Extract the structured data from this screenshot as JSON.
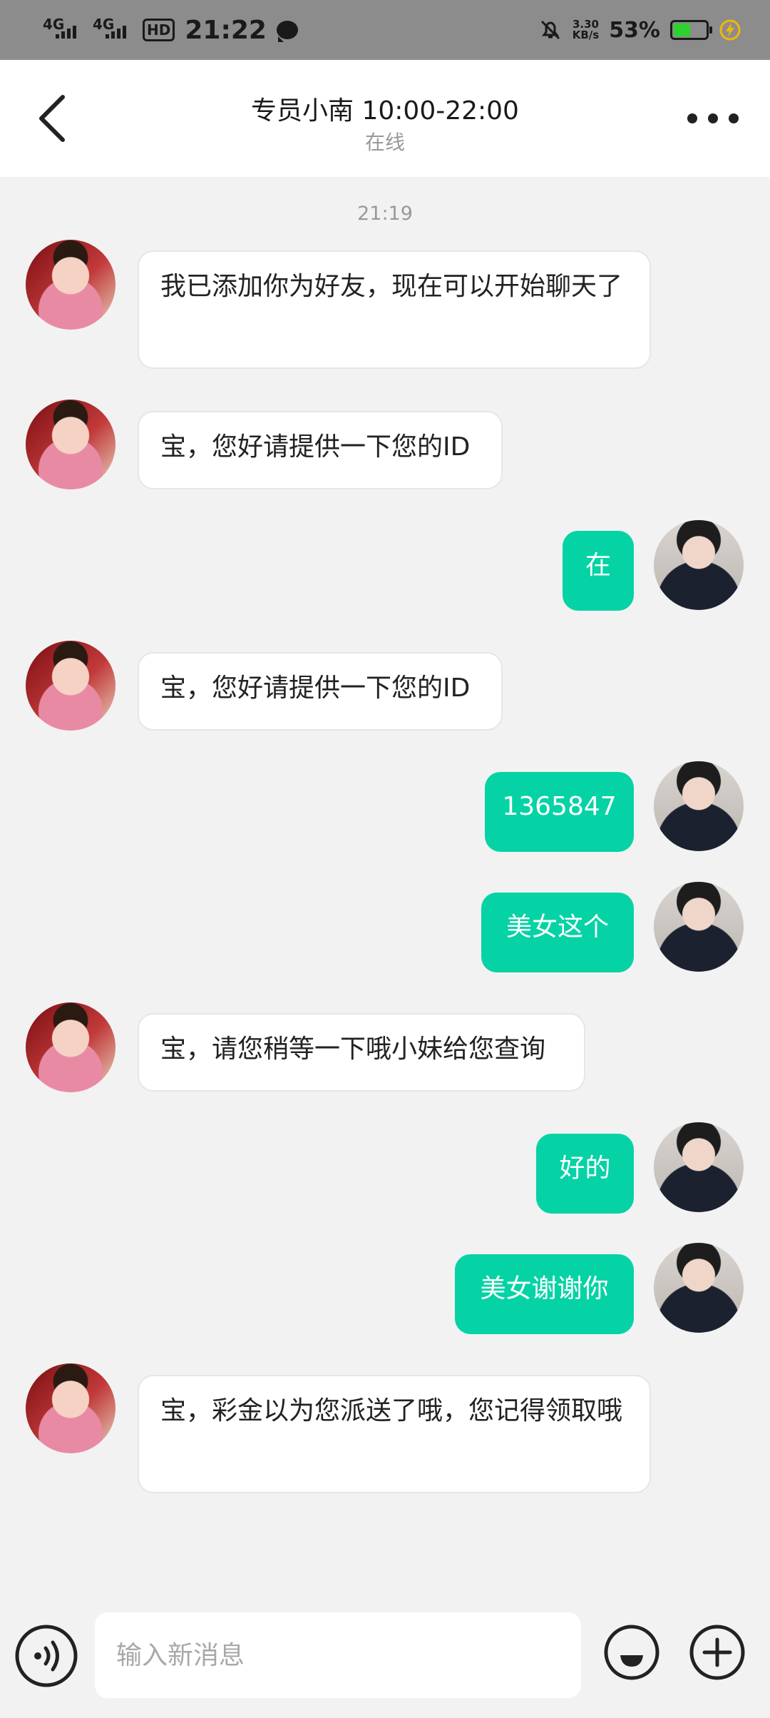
{
  "status_bar": {
    "network_1": "4G",
    "network_2": "4G",
    "hd_label": "HD",
    "time": "21:22",
    "speed_value": "3.30",
    "speed_unit": "KB/s",
    "battery_percent": "53%",
    "battery_level": 0.53,
    "battery_color": "#2ed12e"
  },
  "header": {
    "title": "专员小南 10:00-22:00",
    "status": "在线"
  },
  "chat": {
    "timestamp": "21:19",
    "messages": [
      {
        "side": "in",
        "text": "我已添加你为好友，现在可以开始聊天了"
      },
      {
        "side": "in",
        "text": "宝，您好请提供一下您的ID"
      },
      {
        "side": "out",
        "text": "在"
      },
      {
        "side": "in",
        "text": "宝，您好请提供一下您的ID"
      },
      {
        "side": "out",
        "text": "1365847"
      },
      {
        "side": "out",
        "text": "美女这个"
      },
      {
        "side": "in",
        "text": "宝，请您稍等一下哦小妹给您查询"
      },
      {
        "side": "out",
        "text": "好的"
      },
      {
        "side": "out",
        "text": "美女谢谢你"
      },
      {
        "side": "in",
        "text": "宝，彩金以为您派送了哦，您记得领取哦"
      }
    ]
  },
  "input_bar": {
    "placeholder": "输入新消息",
    "value": ""
  },
  "icons": {
    "back": "chevron-left-icon",
    "more": "more-dots-icon",
    "voice": "voice-icon",
    "emoji": "emoji-icon",
    "plus": "plus-icon"
  },
  "colors": {
    "outgoing_bubble": "#06d3a5",
    "incoming_bubble": "#ffffff",
    "chat_background": "#f2f2f2"
  }
}
